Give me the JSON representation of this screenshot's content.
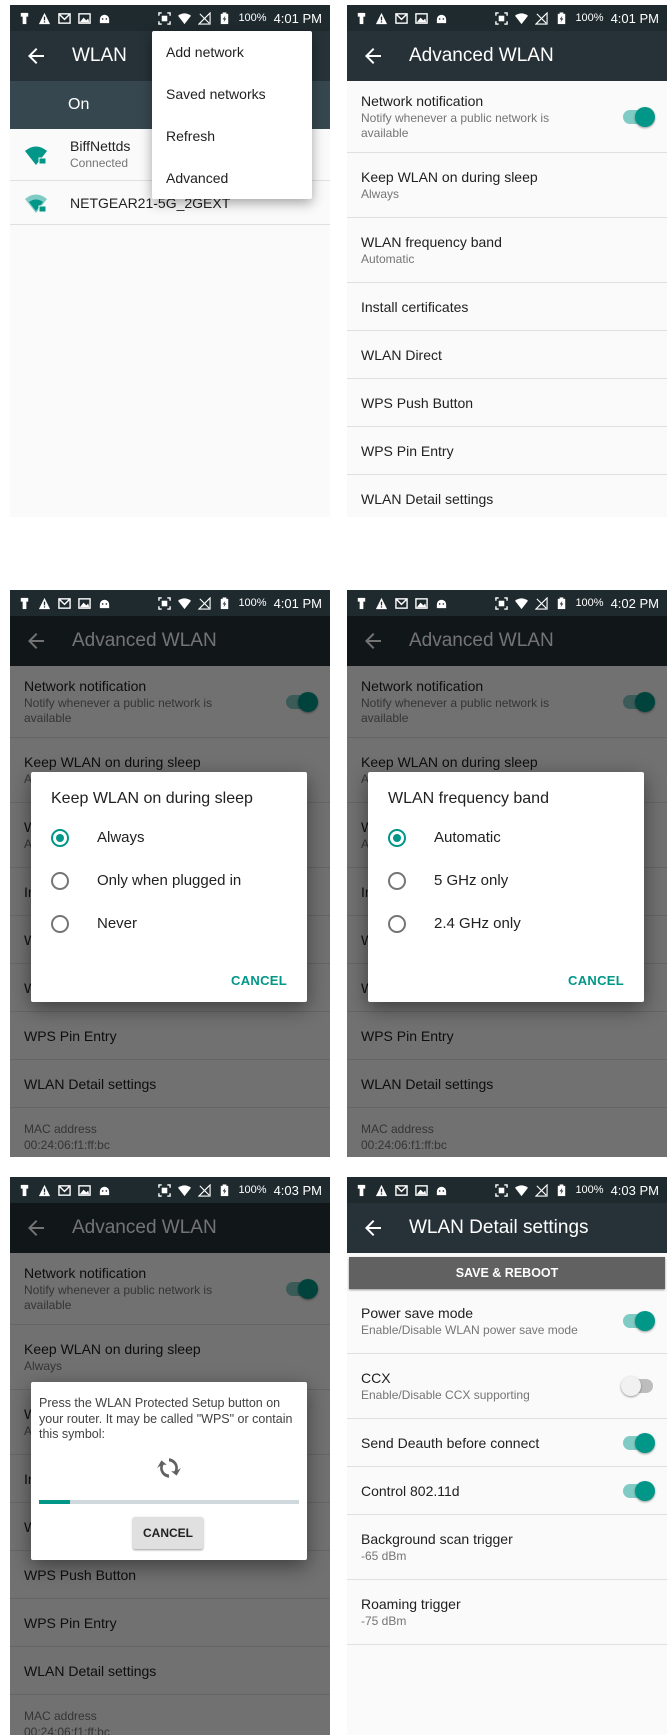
{
  "status_bar": {
    "screen1": {
      "battery": "100%",
      "time": "4:01 PM"
    },
    "screen2": {
      "battery": "100%",
      "time": "4:01 PM"
    },
    "screen3": {
      "battery": "100%",
      "time": "4:01 PM"
    },
    "screen4": {
      "battery": "100%",
      "time": "4:02 PM"
    },
    "screen5": {
      "battery": "100%",
      "time": "4:03 PM"
    },
    "screen6": {
      "battery": "100%",
      "time": "4:03 PM"
    }
  },
  "wlan_screen": {
    "title": "WLAN",
    "switch_label": "On",
    "networks": [
      {
        "name": "BiffNettds",
        "status": "Connected"
      },
      {
        "name": "NETGEAR21-5G_2GEXT",
        "status": ""
      }
    ],
    "overflow_menu": [
      "Add network",
      "Saved networks",
      "Refresh",
      "Advanced"
    ]
  },
  "advanced": {
    "title": "Advanced WLAN",
    "network_notification": {
      "title": "Network notification",
      "subtitle": "Notify whenever a public network is available",
      "enabled": true
    },
    "keep_on_sleep": {
      "title": "Keep WLAN on during sleep",
      "subtitle": "Always"
    },
    "frequency_band": {
      "title": "WLAN frequency band",
      "subtitle": "Automatic"
    },
    "install_certificates": "Install certificates",
    "wlan_direct": "WLAN Direct",
    "wps_push": "WPS Push Button",
    "wps_pin": "WPS Pin Entry",
    "detail_settings": "WLAN Detail settings",
    "mac_label": "MAC address",
    "mac_value": "00:24:06:f1:ff:bc"
  },
  "sleep_dialog": {
    "title": "Keep WLAN on during sleep",
    "options": [
      "Always",
      "Only when plugged in",
      "Never"
    ],
    "selected": "Always",
    "cancel": "CANCEL"
  },
  "band_dialog": {
    "title": "WLAN frequency band",
    "options": [
      "Automatic",
      "5 GHz only",
      "2.4 GHz only"
    ],
    "selected": "Automatic",
    "cancel": "CANCEL"
  },
  "wps_dialog": {
    "message": "Press the WLAN Protected Setup button on your router. It may be called \"WPS\" or contain this symbol:",
    "progress_fraction": 0.12,
    "cancel": "CANCEL"
  },
  "detail": {
    "title": "WLAN Detail settings",
    "save_reboot": "SAVE & REBOOT",
    "items": [
      {
        "title": "Power save mode",
        "subtitle": "Enable/Disable WLAN power save mode",
        "toggle": "on"
      },
      {
        "title": "CCX",
        "subtitle": "Enable/Disable CCX supporting",
        "toggle": "off"
      },
      {
        "title": "Send Deauth before connect",
        "subtitle": "",
        "toggle": "on"
      },
      {
        "title": "Control 802.11d",
        "subtitle": "",
        "toggle": "on"
      },
      {
        "title": "Background scan trigger",
        "subtitle": "-65 dBm",
        "toggle": ""
      },
      {
        "title": "Roaming trigger",
        "subtitle": "-75 dBm",
        "toggle": ""
      }
    ]
  },
  "colors": {
    "accent": "#009688",
    "appbar": "#263238",
    "statusbar": "#1f2a2e"
  }
}
